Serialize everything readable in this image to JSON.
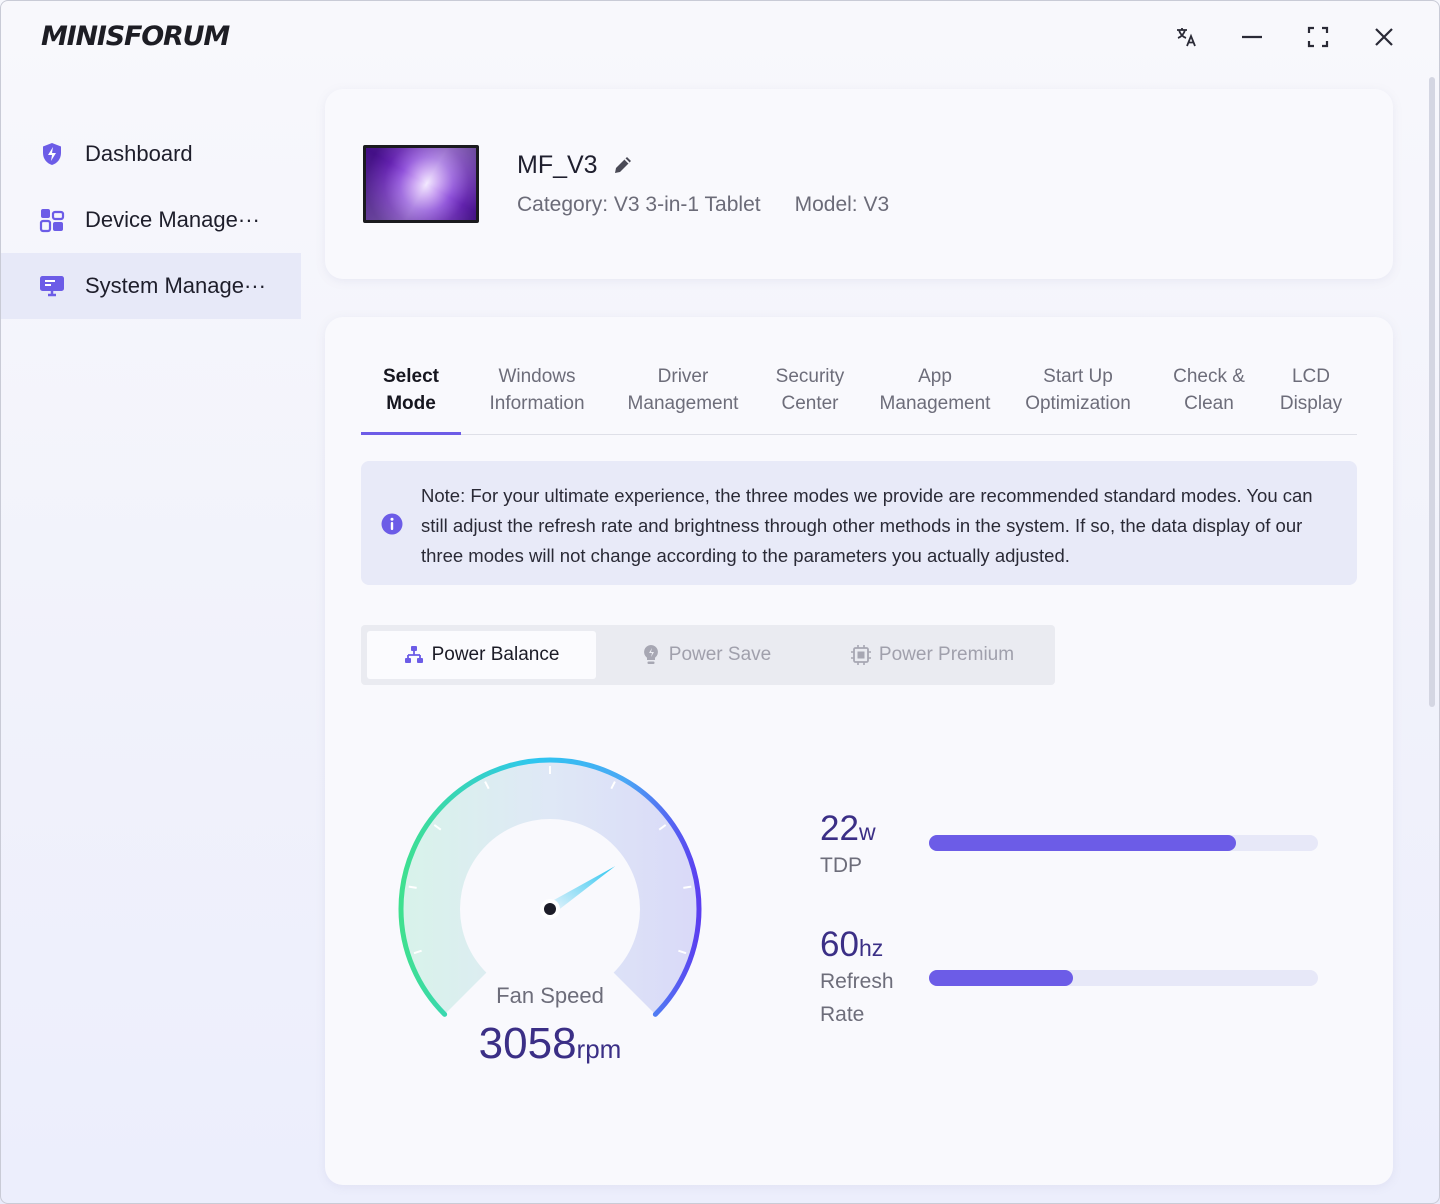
{
  "app": {
    "logo": "MINISFORUM"
  },
  "titlebar": {
    "buttons": [
      "translate-icon",
      "minimize-icon",
      "maximize-icon",
      "close-icon"
    ]
  },
  "sidebar": {
    "items": [
      {
        "label": "Dashboard",
        "icon": "shield-bolt-icon",
        "active": false
      },
      {
        "label": "Device Manage···",
        "icon": "device-grid-icon",
        "active": false
      },
      {
        "label": "System Manage···",
        "icon": "monitor-settings-icon",
        "active": true
      }
    ]
  },
  "device": {
    "name": "MF_V3",
    "category": "Category: V3 3-in-1 Tablet",
    "model": "Model: V3"
  },
  "tabs": [
    {
      "label": "Select\nMode",
      "active": true
    },
    {
      "label": "Windows\nInformation",
      "active": false
    },
    {
      "label": "Driver\nManagement",
      "active": false
    },
    {
      "label": "Security\nCenter",
      "active": false
    },
    {
      "label": "App\nManagement",
      "active": false
    },
    {
      "label": "Start Up\nOptimization",
      "active": false
    },
    {
      "label": "Check &\nClean",
      "active": false
    },
    {
      "label": "LCD\nDisplay",
      "active": false
    }
  ],
  "note": {
    "text": "Note: For your ultimate experience, the three modes we provide are recommended standard modes. You can still adjust the refresh rate and brightness through other methods in the system. If so, the data display of our three modes will not change according to the parameters you actually adjusted."
  },
  "modes": [
    {
      "label": "Power Balance",
      "icon": "network-icon",
      "active": true
    },
    {
      "label": "Power Save",
      "icon": "bulb-icon",
      "active": false
    },
    {
      "label": "Power Premium",
      "icon": "chip-icon",
      "active": false
    }
  ],
  "gauge": {
    "label": "Fan Speed",
    "value": "3058",
    "unit": "rpm",
    "needle_fraction": 0.71
  },
  "stats": {
    "tdp": {
      "value": "22",
      "unit": "w",
      "label": "TDP",
      "fill": 0.79
    },
    "refresh": {
      "value": "60",
      "unit": "hz",
      "label": "Refresh\nRate",
      "fill": 0.37
    }
  },
  "colors": {
    "accent": "#6c5ce7",
    "value_text": "#3b2f86",
    "gauge_start": "#3fe08f",
    "gauge_mid": "#2ec6f0",
    "gauge_end": "#5b3ef0"
  }
}
